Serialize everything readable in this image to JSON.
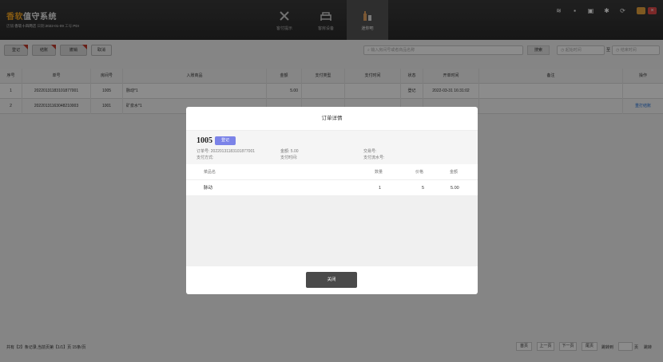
{
  "app": {
    "title_accent": "香软",
    "title_rest": "值守系统",
    "store_label": "店铺:",
    "store_name": "香软十四两店",
    "date_label": "日期:",
    "date_value": "2022-01-09",
    "staff_label": "工号:",
    "staff_value": "PDI"
  },
  "nav": [
    {
      "label": "客付提示",
      "icon": "utensils-icon"
    },
    {
      "label": "客房设备",
      "icon": "bed-icon"
    },
    {
      "label": "迷你吧",
      "icon": "bottle-icon",
      "active": true
    }
  ],
  "toolbar": {
    "buttons": [
      "登记",
      "结账",
      "撤销",
      "取消"
    ],
    "search_placeholder": "输入房间号或者商品名称",
    "search_button": "搜索",
    "start_date_placeholder": "起始时间",
    "date_separator": "至",
    "end_date_placeholder": "结束时间"
  },
  "table": {
    "columns": [
      "序号",
      "单号",
      "房间号",
      "入账商品",
      "金额",
      "支付类型",
      "支付时间",
      "状态",
      "开单时间",
      "备注",
      "操作"
    ],
    "rows": [
      [
        "1",
        "20220131183101877001",
        "1005",
        "脉动*1",
        "5.00",
        "",
        "",
        "登记",
        "2022-03-31 16:31:02",
        "",
        ""
      ],
      [
        "2",
        "20220131163048210003",
        "1001",
        "矿泉水*1",
        "",
        "",
        "",
        "",
        "",
        "",
        "重打结账"
      ]
    ]
  },
  "footer": {
    "info": "共有【2】条记录,当前页第【1/1】页  15条/页",
    "first": "首页",
    "prev": "上一页",
    "next": "下一页",
    "last": "尾页",
    "jump_label": "跳转到",
    "page_suffix": "页",
    "go": "跳转"
  },
  "modal": {
    "title": "订单详情",
    "room": "1005",
    "status_badge": "登记",
    "order_no": "订单号: 20220131183101877001",
    "amount": "金额: 5.00",
    "trade_no": "交易号:",
    "pay_method": "支付方式:",
    "pay_time": "支付时间:",
    "pay_serial": "支付流水号:",
    "items_header": {
      "name": "菜品名",
      "qty": "数量",
      "price": "价格",
      "amount": "金额"
    },
    "items": [
      {
        "name": "脉动",
        "qty": "1",
        "price": "5",
        "amount": "5.00"
      }
    ],
    "close_label": "关闭"
  },
  "colors": {
    "accent": "#f5a623",
    "badge": "#7b83e8",
    "link": "#1e6fd9"
  }
}
